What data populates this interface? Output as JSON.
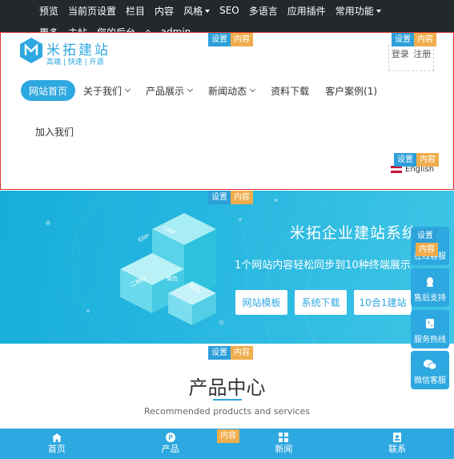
{
  "admin_bar": {
    "row1": [
      {
        "label": "预览",
        "dropdown": false
      },
      {
        "label": "当前页设置",
        "dropdown": false
      },
      {
        "label": "栏目",
        "dropdown": false
      },
      {
        "label": "内容",
        "dropdown": false
      },
      {
        "label": "风格",
        "dropdown": true
      },
      {
        "label": "SEO",
        "dropdown": false
      },
      {
        "label": "多语言",
        "dropdown": false
      },
      {
        "label": "应用插件",
        "dropdown": false
      },
      {
        "label": "常用功能",
        "dropdown": true
      }
    ],
    "row2_partial": [
      "更多",
      "主帖",
      "您的后台",
      "admin"
    ]
  },
  "edit_tags": {
    "set": "设置",
    "content": "内容"
  },
  "header": {
    "logo_name": "米拓建站",
    "logo_slogan": "高端 | 快速 | 开源",
    "login": "登录",
    "register": "注册",
    "language": "English"
  },
  "nav": {
    "items": [
      {
        "label": "网站首页",
        "active": true,
        "dropdown": false
      },
      {
        "label": "关于我们",
        "active": false,
        "dropdown": true
      },
      {
        "label": "产品展示",
        "active": false,
        "dropdown": true
      },
      {
        "label": "新闻动态",
        "active": false,
        "dropdown": true
      },
      {
        "label": "资料下载",
        "active": false,
        "dropdown": false
      },
      {
        "label": "客户案例(1)",
        "active": false,
        "dropdown": false
      }
    ],
    "second_row": "加入我们"
  },
  "banner": {
    "title": "米拓企业建站系统",
    "subtitle": "1个网站内容轻松同步到10种终端展示",
    "buttons": [
      "网站模板",
      "系统下载",
      "10合1建站"
    ],
    "illustration_labels": [
      "ERP",
      "CRM",
      "二维码",
      "微信",
      "网站"
    ]
  },
  "products": {
    "title": "产品中心",
    "subtitle": "Recommended products and services"
  },
  "side_panel": {
    "items": [
      "在线客服",
      "售后支持",
      "服务热线",
      "微信客服"
    ]
  },
  "bottom_nav": {
    "items": [
      "首页",
      "产品",
      "新闻",
      "联系"
    ]
  },
  "colors": {
    "accent": "#2ea8e0",
    "tag_set": "#2d9fd8",
    "tag_content": "#f0ad4e",
    "admin_bar": "#23282d"
  }
}
